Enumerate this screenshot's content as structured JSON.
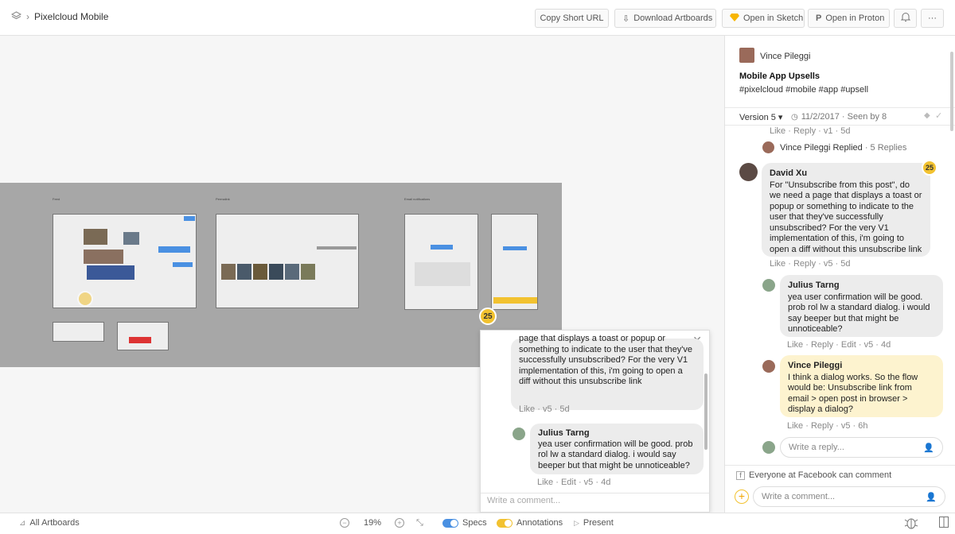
{
  "topbar": {
    "project": "Pixelcloud Mobile",
    "copy_short_url": "Copy Short URL",
    "download_artboards": "Download Artboards",
    "open_in_sketch": "Open in Sketch",
    "open_in_proton": "Open in Proton",
    "more": "···"
  },
  "canvas": {
    "board_labels": [
      "Feed",
      "Permalink",
      "Email notifications"
    ],
    "badge": "25"
  },
  "popup": {
    "text_1": "page that displays a toast or popup or something to indicate to the user that they've successfully unsubscribed? For the very V1 implementation of this, i'm going to open a diff without this unsubscribe link",
    "meta_1": "Like · v5 · 5d",
    "author_2": "Julius Tarng",
    "text_2": "yea user confirmation will be good. prob rol lw a standard dialog. i would say beeper but that might be unnoticeable?",
    "meta_2": "Like · Edit · v5 · 4d",
    "input_placeholder": "Write a comment..."
  },
  "panel": {
    "author": "Vince Pileggi",
    "title": "Mobile App Upsells",
    "tags": "#pixelcloud #mobile #app #upsell",
    "version": "Version 5 ▾",
    "date_seen": "11/2/2017 · Seen by 8",
    "meta_top": "Like · Reply · v1 · 5d",
    "replied_name": "Vince Pileggi Replied",
    "replied_count": "· 5 Replies",
    "comment_1_author": "David Xu",
    "comment_1_text": "For \"Unsubscribe from this post\", do we need a page that displays a toast or popup or something to indicate to the user that they've successfully unsubscribed? For the very V1 implementation of this, i'm going to open a diff without this unsubscribe link",
    "comment_1_badge": "25",
    "comment_1_meta": "Like · Reply · v5 · 5d",
    "reply_1_author": "Julius Tarng",
    "reply_1_text": "yea user confirmation will be good. prob rol lw a standard dialog. i would say beeper but that might be unnoticeable?",
    "reply_1_meta": "Like · Reply · Edit · v5 · 4d",
    "reply_2_author": "Vince Pileggi",
    "reply_2_text": "I think a dialog works. So the flow would be: Unsubscribe link from email > open post in browser > display a dialog?",
    "reply_2_meta": "Like · Reply · v5 · 6h",
    "reply_placeholder": "Write a reply...",
    "permission": "Everyone at Facebook can comment",
    "comment_placeholder": "Write a comment..."
  },
  "bottombar": {
    "all_artboards": "All Artboards",
    "zoom": "19%",
    "specs": "Specs",
    "annotations": "Annotations",
    "present": "Present"
  },
  "colors": {
    "accent_blue": "#4a90e2",
    "badge_yellow": "#f2c230",
    "highlight_yellow": "#fdf3cf"
  }
}
